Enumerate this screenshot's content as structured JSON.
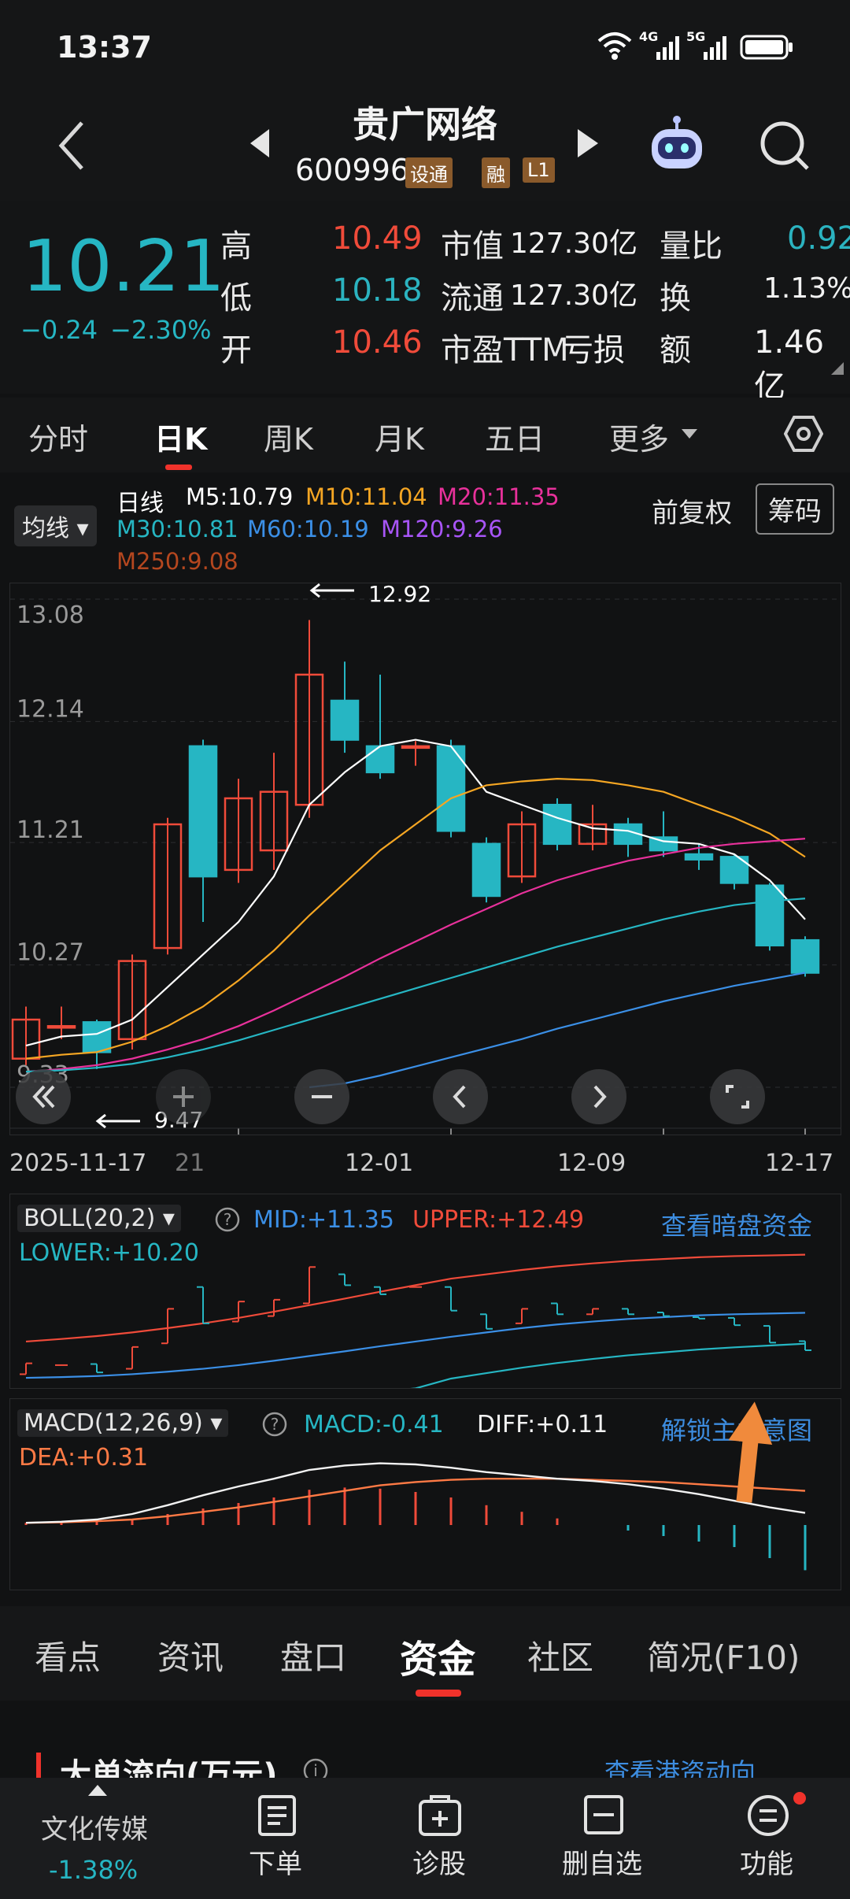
{
  "status_bar": {
    "time": "13:37",
    "net1": "4G",
    "net2": "5G"
  },
  "header": {
    "title": "贵广网络",
    "code": "600996",
    "badges": [
      "设通",
      "融",
      "L1"
    ]
  },
  "quote": {
    "price": "10.21",
    "change": "−0.24",
    "change_pct": "−2.30%",
    "high_label": "高",
    "high": "10.49",
    "low_label": "低",
    "low": "10.18",
    "open_label": "开",
    "open": "10.46",
    "mcap_label": "市值",
    "mcap": "127.30亿",
    "float_label": "流通",
    "float": "127.30亿",
    "pe_label": "市盈TTM",
    "pe": "亏损",
    "vr_label": "量比",
    "vr": "0.92",
    "turnover_label": "换",
    "turnover": "1.13%",
    "amount_label": "额",
    "amount": "1.46亿"
  },
  "tabs": {
    "items": [
      "分时",
      "日K",
      "周K",
      "月K",
      "五日",
      "更多"
    ],
    "active": "日K"
  },
  "ma_legend": {
    "selector": "均线",
    "line": "日线",
    "m5": "M5:10.79",
    "m10": "M10:11.04",
    "m20": "M20:11.35",
    "m30": "M30:10.81",
    "m60": "M60:10.19",
    "m120": "M120:9.26",
    "m250": "M250:9.08",
    "adjust": "前复权",
    "chips": "筹码",
    "colors": {
      "m5": "#ffffff",
      "m10": "#f5a623",
      "m20": "#e8319b",
      "m30": "#26b6c3",
      "m60": "#3b8fe6",
      "m120": "#a855f7",
      "m250": "#b5471f"
    }
  },
  "chart_data": {
    "type": "candlestick",
    "y_ticks": [
      "13.08",
      "12.14",
      "11.21",
      "10.27",
      "9.33"
    ],
    "ylim": [
      9.33,
      13.08
    ],
    "x_labels": [
      "2025-11-17",
      "21",
      "12-01",
      "12-09",
      "12-17"
    ],
    "high_annotation": "12.92",
    "low_annotation": "9.47",
    "candles": [
      {
        "o": 9.55,
        "c": 9.85,
        "h": 9.95,
        "l": 9.5
      },
      {
        "o": 9.8,
        "c": 9.8,
        "h": 9.95,
        "l": 9.7
      },
      {
        "o": 9.83,
        "c": 9.6,
        "h": 9.85,
        "l": 9.47
      },
      {
        "o": 9.7,
        "c": 10.3,
        "h": 10.35,
        "l": 9.62
      },
      {
        "o": 10.4,
        "c": 11.35,
        "h": 11.4,
        "l": 10.35
      },
      {
        "o": 11.95,
        "c": 10.95,
        "h": 12.0,
        "l": 10.6
      },
      {
        "o": 11.0,
        "c": 11.55,
        "h": 11.7,
        "l": 10.9
      },
      {
        "o": 11.15,
        "c": 11.6,
        "h": 11.9,
        "l": 11.0
      },
      {
        "o": 11.5,
        "c": 12.5,
        "h": 12.92,
        "l": 11.4
      },
      {
        "o": 12.3,
        "c": 12.0,
        "h": 12.6,
        "l": 11.9
      },
      {
        "o": 11.95,
        "c": 11.75,
        "h": 12.5,
        "l": 11.7
      },
      {
        "o": 11.95,
        "c": 11.95,
        "h": 11.99,
        "l": 11.8
      },
      {
        "o": 11.95,
        "c": 11.3,
        "h": 12.0,
        "l": 11.25
      },
      {
        "o": 11.2,
        "c": 10.8,
        "h": 11.25,
        "l": 10.75
      },
      {
        "o": 10.95,
        "c": 11.35,
        "h": 11.45,
        "l": 10.9
      },
      {
        "o": 11.5,
        "c": 11.2,
        "h": 11.55,
        "l": 11.15
      },
      {
        "o": 11.2,
        "c": 11.35,
        "h": 11.5,
        "l": 11.15
      },
      {
        "o": 11.35,
        "c": 11.2,
        "h": 11.4,
        "l": 11.1
      },
      {
        "o": 11.25,
        "c": 11.15,
        "h": 11.45,
        "l": 11.1
      },
      {
        "o": 11.12,
        "c": 11.08,
        "h": 11.2,
        "l": 11.0
      },
      {
        "o": 11.1,
        "c": 10.9,
        "h": 11.12,
        "l": 10.85
      },
      {
        "o": 10.88,
        "c": 10.42,
        "h": 10.9,
        "l": 10.38
      },
      {
        "o": 10.46,
        "c": 10.21,
        "h": 10.49,
        "l": 10.18
      }
    ],
    "series": [
      {
        "key": "m5",
        "values": [
          9.65,
          9.72,
          9.74,
          9.85,
          10.1,
          10.35,
          10.6,
          10.95,
          11.5,
          11.75,
          11.95,
          12.0,
          11.95,
          11.6,
          11.5,
          11.4,
          11.32,
          11.3,
          11.22,
          11.2,
          11.12,
          10.92,
          10.62
        ]
      },
      {
        "key": "m10",
        "values": [
          9.55,
          9.58,
          9.6,
          9.68,
          9.8,
          9.95,
          10.15,
          10.38,
          10.65,
          10.9,
          11.15,
          11.35,
          11.55,
          11.65,
          11.68,
          11.7,
          11.69,
          11.65,
          11.6,
          11.5,
          11.4,
          11.28,
          11.1
        ]
      },
      {
        "key": "m20",
        "values": [
          9.45,
          9.47,
          9.5,
          9.55,
          9.62,
          9.7,
          9.8,
          9.92,
          10.05,
          10.18,
          10.32,
          10.45,
          10.58,
          10.7,
          10.82,
          10.92,
          11.0,
          11.07,
          11.12,
          11.17,
          11.2,
          11.22,
          11.24
        ]
      },
      {
        "key": "m30",
        "values": [
          9.45,
          9.46,
          9.48,
          9.51,
          9.56,
          9.62,
          9.69,
          9.77,
          9.85,
          9.93,
          10.01,
          10.09,
          10.17,
          10.25,
          10.33,
          10.41,
          10.48,
          10.55,
          10.62,
          10.68,
          10.73,
          10.76,
          10.78
        ]
      },
      {
        "key": "m60",
        "values": [
          null,
          null,
          null,
          null,
          null,
          null,
          null,
          null,
          9.33,
          9.36,
          9.42,
          9.49,
          9.56,
          9.63,
          9.7,
          9.78,
          9.85,
          9.92,
          9.99,
          10.05,
          10.11,
          10.16,
          10.21
        ]
      }
    ],
    "boll": {
      "title": "BOLL(20,2)",
      "mid": "MID:+11.35",
      "upper": "UPPER:+12.49",
      "lower": "LOWER:+10.20",
      "link": "查看暗盘资金"
    },
    "macd": {
      "title": "MACD(12,26,9)",
      "macd": "MACD:-0.41",
      "diff": "DIFF:+0.11",
      "dea": "DEA:+0.31",
      "link": "解锁主力意图",
      "hist": [
        0.02,
        0.02,
        0.03,
        0.05,
        0.1,
        0.15,
        0.2,
        0.25,
        0.32,
        0.34,
        0.33,
        0.3,
        0.25,
        0.18,
        0.12,
        0.06,
        0.0,
        -0.05,
        -0.1,
        -0.15,
        -0.2,
        -0.3,
        -0.41
      ]
    }
  },
  "controls": [
    "collapse-left",
    "zoom-in",
    "zoom-out",
    "prev",
    "next",
    "fullscreen"
  ],
  "bottom_tabs": {
    "items": [
      "看点",
      "资讯",
      "盘口",
      "资金",
      "社区",
      "简况(F10)"
    ],
    "active": "资金"
  },
  "section": {
    "title": "大单流向(万元)",
    "link": "查看港资动向"
  },
  "navbar": {
    "sector": "文化传媒",
    "sector_chg": "-1.38%",
    "items": [
      "下单",
      "诊股",
      "删自选",
      "功能"
    ]
  }
}
